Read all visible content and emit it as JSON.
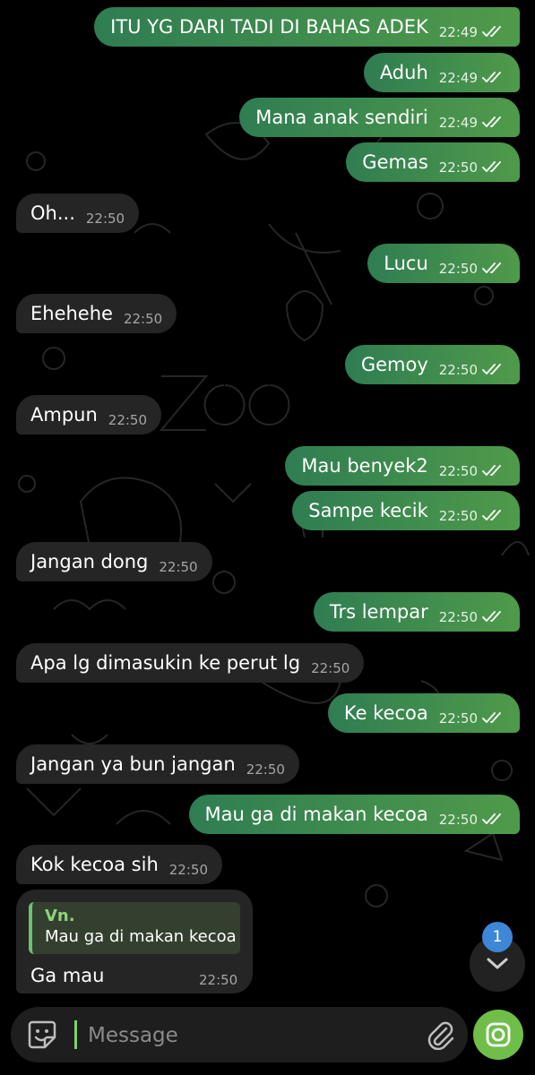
{
  "messages": [
    {
      "dir": "out",
      "text": "ITU YG DARI TADI DI BAHAS ADEK",
      "time": "22:49",
      "read": true
    },
    {
      "dir": "out",
      "text": "Aduh",
      "time": "22:49",
      "read": true
    },
    {
      "dir": "out",
      "text": "Mana anak sendiri",
      "time": "22:49",
      "read": true
    },
    {
      "dir": "out",
      "text": "Gemas",
      "time": "22:50",
      "read": true
    },
    {
      "dir": "in",
      "text": "Oh...",
      "time": "22:50"
    },
    {
      "dir": "out",
      "text": "Lucu",
      "time": "22:50",
      "read": true
    },
    {
      "dir": "in",
      "text": "Ehehehe",
      "time": "22:50"
    },
    {
      "dir": "out",
      "text": "Gemoy",
      "time": "22:50",
      "read": true
    },
    {
      "dir": "in",
      "text": "Ampun",
      "time": "22:50"
    },
    {
      "dir": "out",
      "text": "Mau benyek2",
      "time": "22:50",
      "read": true
    },
    {
      "dir": "out",
      "text": "Sampe kecik",
      "time": "22:50",
      "read": true
    },
    {
      "dir": "in",
      "text": "Jangan dong",
      "time": "22:50"
    },
    {
      "dir": "out",
      "text": "Trs lempar",
      "time": "22:50",
      "read": true
    },
    {
      "dir": "in",
      "text": "Apa lg dimasukin ke perut lg",
      "time": "22:50"
    },
    {
      "dir": "out",
      "text": "Ke kecoa",
      "time": "22:50",
      "read": true
    },
    {
      "dir": "in",
      "text": "Jangan ya bun jangan",
      "time": "22:50"
    },
    {
      "dir": "out",
      "text": "Mau ga di makan kecoa",
      "time": "22:50",
      "read": true
    },
    {
      "dir": "in",
      "text": "Kok kecoa sih",
      "time": "22:50"
    }
  ],
  "reply_message": {
    "quoted_author": "Vn.",
    "quoted_text": "Mau ga di makan kecoa",
    "text": "Ga mau",
    "time": "22:50"
  },
  "unread_count": "1",
  "composer": {
    "placeholder": "Message"
  },
  "icons": {
    "emoji": "sticker-icon",
    "attach": "paperclip-icon",
    "camera": "camera-icon",
    "scroll": "chevron-down-icon",
    "read_receipt": "double-check-icon"
  },
  "colors": {
    "outgoing_bubble_start": "#2f7d52",
    "outgoing_bubble_end": "#4f9a4a",
    "incoming_bubble": "#252525",
    "background": "#000000",
    "quote_author": "#8fd47c",
    "unread_badge": "#3e86d6",
    "camera_button": "#6fbe4a"
  }
}
